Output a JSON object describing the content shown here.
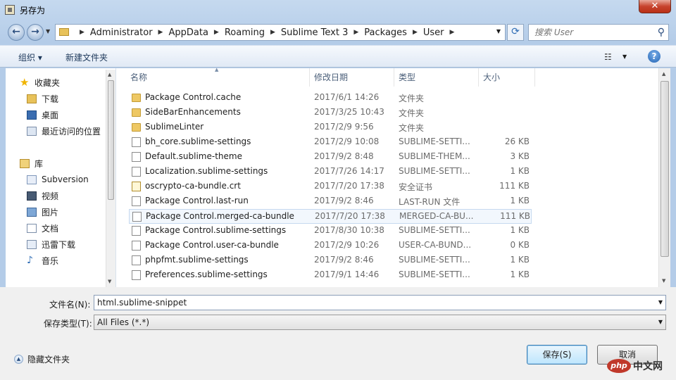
{
  "window": {
    "title": "另存为",
    "close_label": "✕"
  },
  "address": {
    "breadcrumbs": [
      "Administrator",
      "AppData",
      "Roaming",
      "Sublime Text 3",
      "Packages",
      "User"
    ],
    "search_placeholder": "搜索 User"
  },
  "toolbar": {
    "organize": "组织 ▾",
    "new_folder": "新建文件夹"
  },
  "sidebar": {
    "favorites": "收藏夹",
    "downloads": "下载",
    "desktop": "桌面",
    "recent": "最近访问的位置",
    "libraries": "库",
    "subversion": "Subversion",
    "videos": "视频",
    "pictures": "图片",
    "documents": "文档",
    "thunder": "迅雷下载",
    "music": "音乐"
  },
  "columns": {
    "name": "名称",
    "date": "修改日期",
    "type": "类型",
    "size": "大小"
  },
  "files": [
    {
      "icon": "folder",
      "name": "Package Control.cache",
      "date": "2017/6/1 14:26",
      "type": "文件夹",
      "size": ""
    },
    {
      "icon": "folder",
      "name": "SideBarEnhancements",
      "date": "2017/3/25 10:43",
      "type": "文件夹",
      "size": ""
    },
    {
      "icon": "folder",
      "name": "SublimeLinter",
      "date": "2017/2/9 9:56",
      "type": "文件夹",
      "size": ""
    },
    {
      "icon": "file",
      "name": "bh_core.sublime-settings",
      "date": "2017/2/9 10:08",
      "type": "SUBLIME-SETTI...",
      "size": "26 KB"
    },
    {
      "icon": "file",
      "name": "Default.sublime-theme",
      "date": "2017/9/2 8:48",
      "type": "SUBLIME-THEM...",
      "size": "3 KB"
    },
    {
      "icon": "file",
      "name": "Localization.sublime-settings",
      "date": "2017/7/26 14:17",
      "type": "SUBLIME-SETTI...",
      "size": "1 KB"
    },
    {
      "icon": "cert",
      "name": "oscrypto-ca-bundle.crt",
      "date": "2017/7/20 17:38",
      "type": "安全证书",
      "size": "111 KB"
    },
    {
      "icon": "file",
      "name": "Package Control.last-run",
      "date": "2017/9/2 8:46",
      "type": "LAST-RUN 文件",
      "size": "1 KB"
    },
    {
      "icon": "file",
      "name": "Package Control.merged-ca-bundle",
      "date": "2017/7/20 17:38",
      "type": "MERGED-CA-BU...",
      "size": "111 KB"
    },
    {
      "icon": "file",
      "name": "Package Control.sublime-settings",
      "date": "2017/8/30 10:38",
      "type": "SUBLIME-SETTI...",
      "size": "1 KB"
    },
    {
      "icon": "file",
      "name": "Package Control.user-ca-bundle",
      "date": "2017/2/9 10:26",
      "type": "USER-CA-BUND...",
      "size": "0 KB"
    },
    {
      "icon": "file",
      "name": "phpfmt.sublime-settings",
      "date": "2017/9/2 8:46",
      "type": "SUBLIME-SETTI...",
      "size": "1 KB"
    },
    {
      "icon": "file",
      "name": "Preferences.sublime-settings",
      "date": "2017/9/1 14:46",
      "type": "SUBLIME-SETTI...",
      "size": "1 KB"
    }
  ],
  "selected_row": 8,
  "form": {
    "filename_label": "文件名(N):",
    "filename_value": "html.sublime-snippet",
    "filetype_label": "保存类型(T):",
    "filetype_value": "All Files (*.*)",
    "hide_folders": "隐藏文件夹",
    "save": "保存(S)",
    "cancel": "取消"
  },
  "watermark": {
    "logo": "php",
    "text": "中文网"
  }
}
